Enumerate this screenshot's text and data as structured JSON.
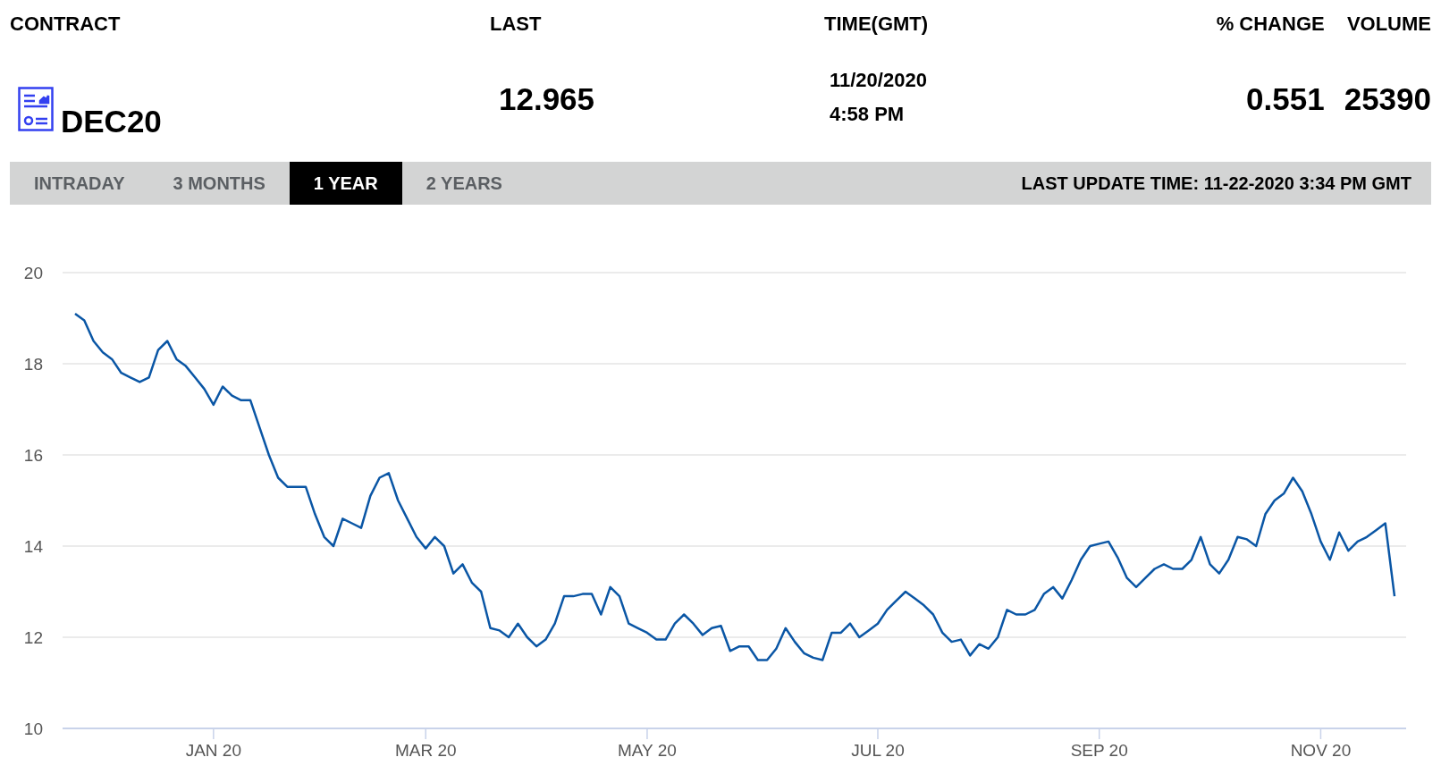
{
  "header": {
    "columns": [
      {
        "label": "CONTRACT"
      },
      {
        "label": "LAST"
      },
      {
        "label": "TIME(GMT)"
      },
      {
        "label": "% CHANGE"
      },
      {
        "label": "VOLUME"
      }
    ],
    "contract": "DEC20",
    "last": "12.965",
    "date": "11/20/2020",
    "time": "4:58 PM",
    "change": "0.551",
    "volume": "25390"
  },
  "tabs": [
    {
      "label": "INTRADAY",
      "selected": false
    },
    {
      "label": "3 MONTHS",
      "selected": false
    },
    {
      "label": "1 YEAR",
      "selected": true
    },
    {
      "label": "2 YEARS",
      "selected": false
    }
  ],
  "last_update": "LAST UPDATE TIME: 11-22-2020 3:34 PM GMT",
  "chart": {
    "chart_data": {
      "type": "line",
      "categories": [
        null,
        null,
        null,
        null,
        null,
        null,
        null,
        null,
        null,
        null,
        null,
        null,
        null,
        null,
        null,
        "JAN 20",
        null,
        null,
        null,
        null,
        null,
        null,
        null,
        null,
        null,
        null,
        null,
        null,
        null,
        null,
        null,
        null,
        null,
        null,
        null,
        null,
        null,
        null,
        "MAR 20",
        null,
        null,
        null,
        null,
        null,
        null,
        null,
        null,
        null,
        null,
        null,
        null,
        null,
        null,
        null,
        null,
        null,
        null,
        null,
        null,
        null,
        null,
        null,
        "MAY 20",
        null,
        null,
        null,
        null,
        null,
        null,
        null,
        null,
        null,
        null,
        null,
        null,
        null,
        null,
        null,
        null,
        null,
        null,
        null,
        null,
        null,
        null,
        null,
        null,
        "JUL 20",
        null,
        null,
        null,
        null,
        null,
        null,
        null,
        null,
        null,
        null,
        null,
        null,
        null,
        null,
        null,
        null,
        null,
        null,
        null,
        null,
        null,
        null,
        null,
        "SEP 20",
        null,
        null,
        null,
        null,
        null,
        null,
        null,
        null,
        null,
        null,
        null,
        null,
        null,
        null,
        null,
        null,
        null,
        null,
        null,
        null,
        null,
        null,
        null,
        "NOV 20",
        null,
        null,
        null,
        null,
        null,
        null,
        null,
        null
      ],
      "series": [
        {
          "color": "#0a56a5",
          "values": [
            19.1,
            18.95,
            18.5,
            18.25,
            18.1,
            17.8,
            17.7,
            17.6,
            17.7,
            18.3,
            18.5,
            18.1,
            17.95,
            17.7,
            17.45,
            17.1,
            17.5,
            17.3,
            17.2,
            17.2,
            16.6,
            16.0,
            15.5,
            15.3,
            15.3,
            15.3,
            14.7,
            14.2,
            14.0,
            14.6,
            14.5,
            14.4,
            15.1,
            15.5,
            15.6,
            15.0,
            14.6,
            14.2,
            13.95,
            14.2,
            14.0,
            13.4,
            13.6,
            13.2,
            13.0,
            12.2,
            12.15,
            12.0,
            12.3,
            12.0,
            11.8,
            11.95,
            12.3,
            12.9,
            12.9,
            12.95,
            12.95,
            12.5,
            13.1,
            12.9,
            12.3,
            12.2,
            12.1,
            11.95,
            11.95,
            12.3,
            12.5,
            12.3,
            12.05,
            12.2,
            12.25,
            11.7,
            11.8,
            11.8,
            11.5,
            11.5,
            11.75,
            12.2,
            11.9,
            11.65,
            11.55,
            11.5,
            12.1,
            12.1,
            12.3,
            12.0,
            12.15,
            12.3,
            12.6,
            12.8,
            13.0,
            12.85,
            12.7,
            12.5,
            12.1,
            11.9,
            11.95,
            11.6,
            11.85,
            11.75,
            12.0,
            12.6,
            12.5,
            12.5,
            12.6,
            12.95,
            13.1,
            12.85,
            13.25,
            13.7,
            14.0,
            14.05,
            14.1,
            13.75,
            13.3,
            13.1,
            13.3,
            13.5,
            13.6,
            13.5,
            13.5,
            13.7,
            14.2,
            13.6,
            13.4,
            13.7,
            14.2,
            14.15,
            14.0,
            14.7,
            15.0,
            15.15,
            15.5,
            15.2,
            14.7,
            14.1,
            13.7,
            14.3,
            13.9,
            14.1,
            14.2,
            14.35,
            14.5,
            12.9
          ]
        }
      ],
      "ylim": [
        10,
        20
      ],
      "grid": true,
      "yticks": [
        10,
        12,
        14,
        16,
        18,
        20
      ]
    }
  }
}
